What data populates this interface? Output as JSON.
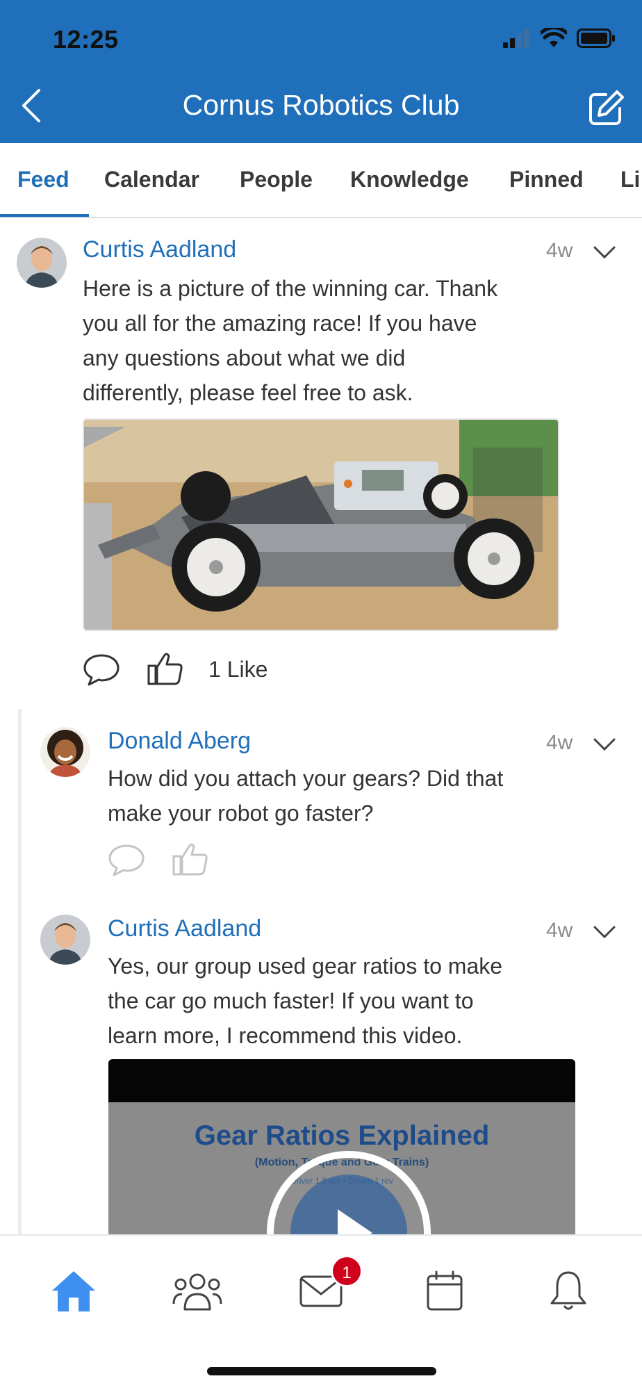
{
  "status": {
    "time": "12:25"
  },
  "header": {
    "title": "Cornus Robotics Club"
  },
  "tabs": [
    {
      "label": "Feed"
    },
    {
      "label": "Calendar"
    },
    {
      "label": "People"
    },
    {
      "label": "Knowledge"
    },
    {
      "label": "Pinned"
    },
    {
      "label": "Li"
    }
  ],
  "posts": {
    "main": {
      "author": "Curtis Aadland",
      "time": "4w",
      "lines": [
        "Here is a picture of the winning car. Thank",
        "you all for the amazing race! If you have",
        "any questions about what we did",
        "differently, please feel free to ask."
      ],
      "likes": "1 Like"
    },
    "reply1": {
      "author": "Donald Aberg",
      "time": "4w",
      "lines": [
        "How did you attach your gears? Did that",
        "make your robot go faster?"
      ]
    },
    "reply2": {
      "author": "Curtis Aadland",
      "time": "4w",
      "lines": [
        "Yes, our group used gear ratios to make",
        "the car go much faster! If you want to",
        "learn more, I recommend this video."
      ],
      "video": {
        "title": "Gear Ratios Explained",
        "subtitle": "(Motion, Torque and Gear Trains)",
        "caption": "Driver 1.8 rev • Driven 1 rev"
      }
    }
  },
  "bottom_nav": {
    "inbox_badge": "1"
  },
  "colors": {
    "brand": "#1f6fba",
    "badge": "#d0021b"
  }
}
